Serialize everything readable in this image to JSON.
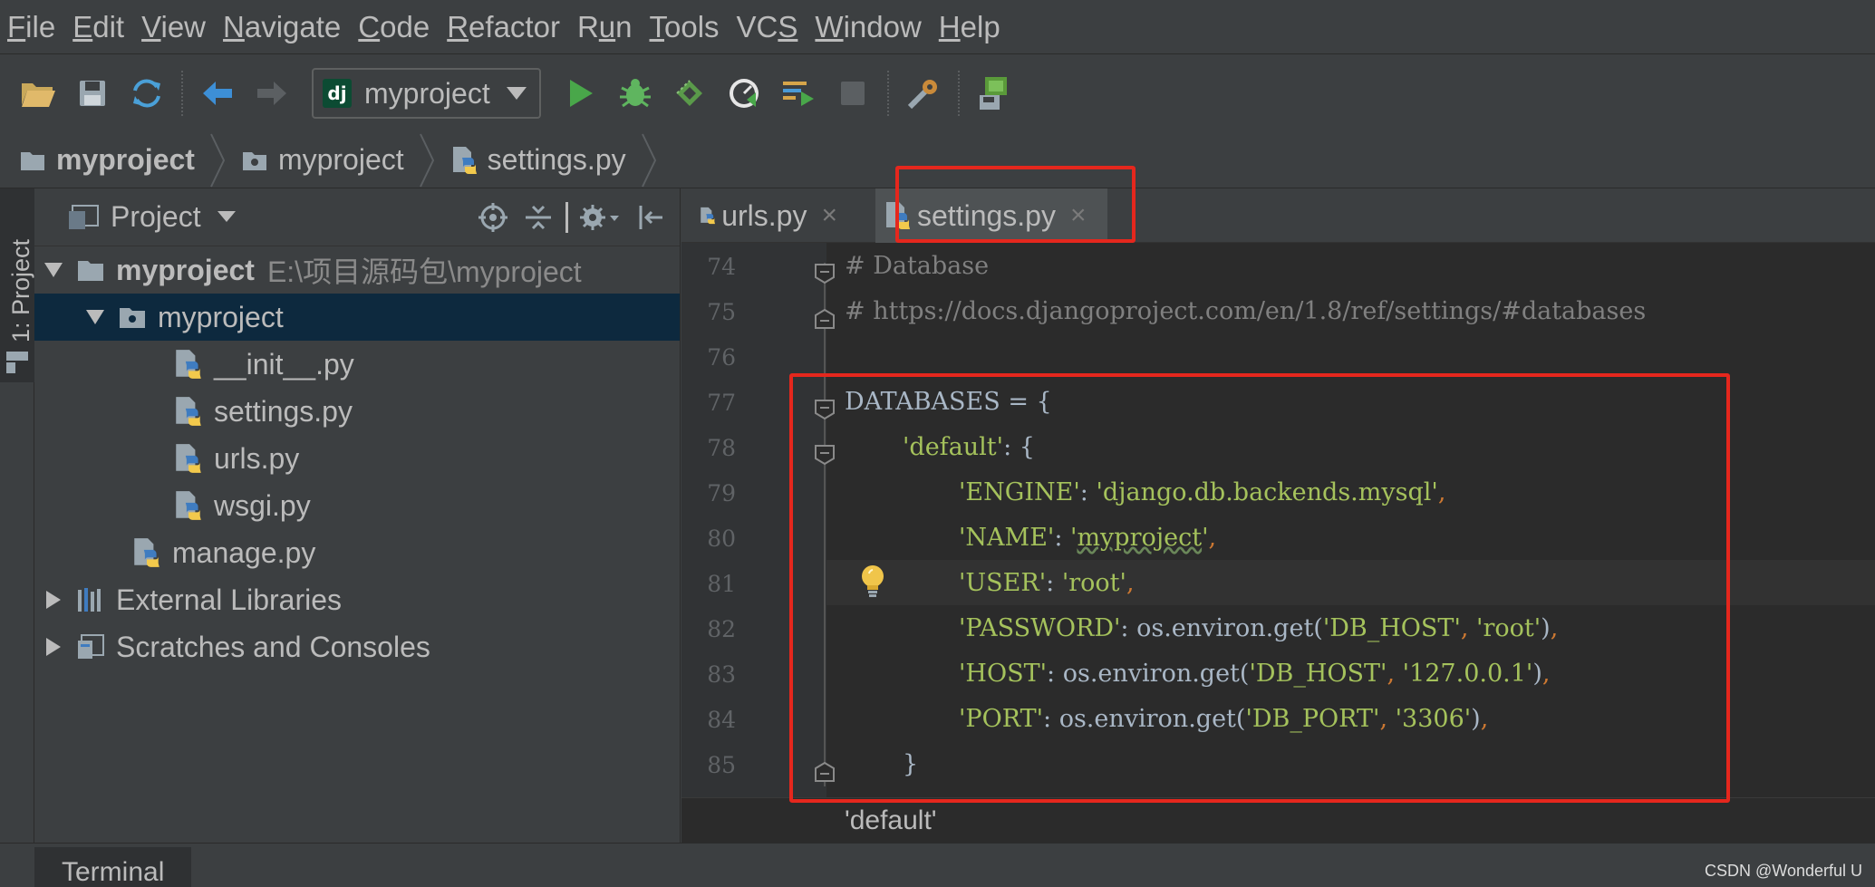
{
  "menu": [
    {
      "mnemonic": "F",
      "rest": "ile"
    },
    {
      "mnemonic": "E",
      "rest": "dit"
    },
    {
      "mnemonic": "V",
      "rest": "iew"
    },
    {
      "mnemonic": "N",
      "rest": "avigate"
    },
    {
      "mnemonic": "C",
      "rest": "ode"
    },
    {
      "mnemonic": "R",
      "rest": "efactor"
    },
    {
      "pre": "R",
      "mnemonic": "u",
      "rest": "n"
    },
    {
      "mnemonic": "T",
      "rest": "ools"
    },
    {
      "pre": "VC",
      "mnemonic": "S",
      "rest": ""
    },
    {
      "mnemonic": "W",
      "rest": "indow"
    },
    {
      "mnemonic": "H",
      "rest": "elp"
    }
  ],
  "toolbar": {
    "run_config": "myproject",
    "run_config_badge": "dj",
    "icons": [
      "open-folder-icon",
      "save-all-icon",
      "sync-icon",
      "back-arrow-icon",
      "forward-arrow-icon",
      "run-icon",
      "debug-icon",
      "coverage-icon",
      "profile-icon",
      "concurrency-icon",
      "stop-icon",
      "settings-wrench-icon",
      "sdk-icon"
    ]
  },
  "breadcrumb": [
    "myproject",
    "myproject",
    "settings.py"
  ],
  "left_strip": {
    "tab_label": "1: Project"
  },
  "project_panel": {
    "title": "Project",
    "tree": {
      "root": {
        "name": "myproject",
        "path": "E:\\项目源码包\\myproject"
      },
      "package": "myproject",
      "package_files": [
        "__init__.py",
        "settings.py",
        "urls.py",
        "wsgi.py"
      ],
      "root_files": [
        "manage.py"
      ],
      "external": "External Libraries",
      "scratches": "Scratches and Consoles"
    }
  },
  "editor": {
    "tabs": [
      {
        "label": "urls.py",
        "close": "×"
      },
      {
        "label": "settings.py",
        "close": "×",
        "active": true
      }
    ],
    "line_numbers": [
      "74",
      "75",
      "76",
      "77",
      "78",
      "79",
      "80",
      "81",
      "82",
      "83",
      "84",
      "85"
    ],
    "code": {
      "l74": "# Database",
      "l75": "# https://docs.djangoproject.com/en/1.8/ref/settings/#databases",
      "l77_var": "DATABASES = {",
      "l78_key": "'default'",
      "l78_rest": ": {",
      "l79_key": "'ENGINE'",
      "l79_sep": ": ",
      "l79_val": "'django.db.backends.mysql'",
      "l80_key": "'NAME'",
      "l80_sep": ": ",
      "l80_q1": "'",
      "l80_val": "myproject",
      "l80_q2": "'",
      "l81_key": "'USER'",
      "l81_sep": ": ",
      "l81_val": "'root'",
      "l82_key": "'PASSWORD'",
      "l82_sep": ": os.environ.get(",
      "l82_a1": "'DB_HOST'",
      "l82_a2": "'root'",
      "l83_key": "'HOST'",
      "l83_sep": ": os.environ.get(",
      "l83_a1": "'DB_HOST'",
      "l83_a2": "'127.0.0.1'",
      "l84_key": "'PORT'",
      "l84_sep": ": os.environ.get(",
      "l84_a1": "'DB_PORT'",
      "l84_a2": "'3306'",
      "l85": "}",
      "comma": ",",
      "comma_sp": ", ",
      "close_paren": ")"
    },
    "context_breadcrumb": "'default'",
    "highlight_color": "#e5271d"
  },
  "bottom": {
    "terminal_label": "Terminal",
    "watermark": "CSDN @Wonderful    U"
  },
  "colors": {
    "background": "#3c3f41",
    "editor_bg": "#2b2b2b",
    "string": "#a5c25c",
    "comment": "#808080",
    "keyword_punct": "#cc7832",
    "selection": "#0d293e"
  }
}
